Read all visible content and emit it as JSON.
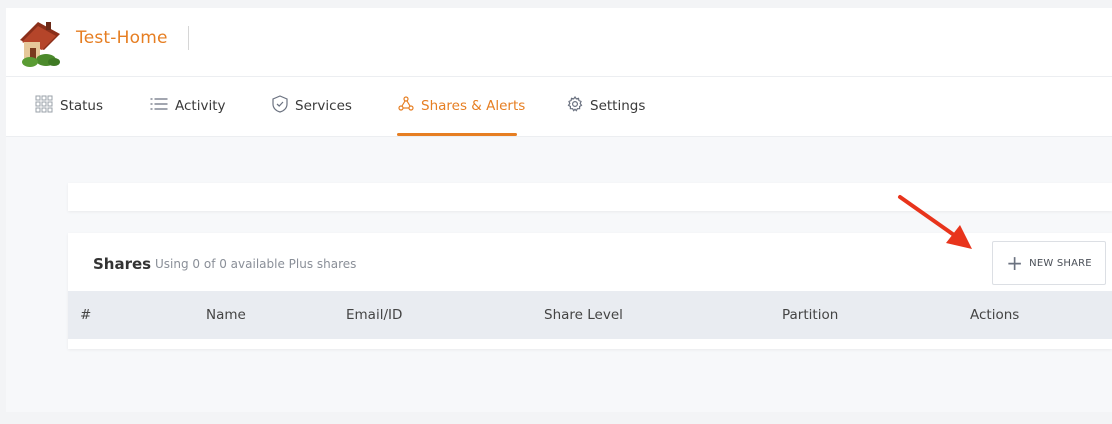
{
  "header": {
    "app_title": "Test-Home"
  },
  "nav": {
    "tabs": [
      {
        "label": "Status",
        "icon": "grid-icon"
      },
      {
        "label": "Activity",
        "icon": "list-icon"
      },
      {
        "label": "Services",
        "icon": "shield-icon"
      },
      {
        "label": "Shares & Alerts",
        "icon": "share-nodes-icon",
        "active": true
      },
      {
        "label": "Settings",
        "icon": "gear-icon"
      }
    ]
  },
  "shares": {
    "title": "Shares",
    "subtitle": "Using 0 of 0 available Plus shares",
    "new_share_label": "NEW SHARE",
    "columns": [
      "#",
      "Name",
      "Email/ID",
      "Share Level",
      "Partition",
      "Actions"
    ],
    "rows": []
  },
  "colors": {
    "accent": "#e67e22",
    "annotation_arrow": "#e8341c"
  }
}
